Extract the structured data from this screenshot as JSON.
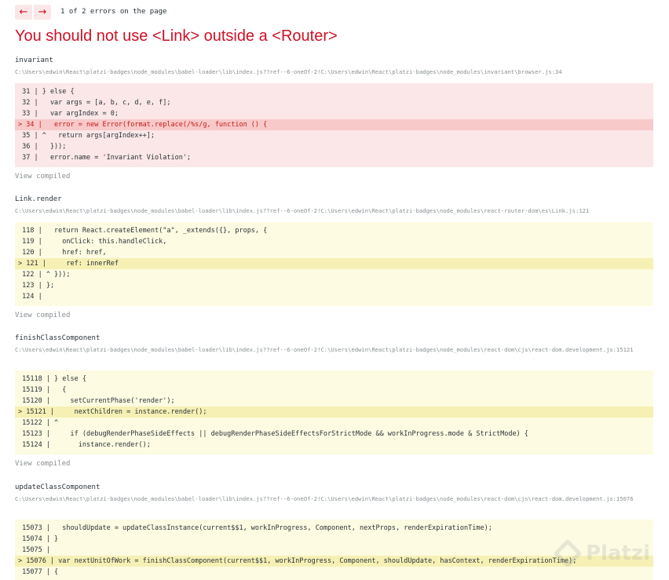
{
  "nav": {
    "prev": "←",
    "next": "→",
    "count": "1 of 2 errors on the page"
  },
  "title": "You should not use <Link> outside a <Router>",
  "frames": [
    {
      "name": "invariant",
      "file": "C:\\Users\\edwin\\React\\platzi-badges\\node_modules\\babel-loader\\lib\\index.js??ref--6-oneOf-2!C:\\Users\\edwin\\React\\platzi-badges\\node_modules\\invariant\\browser.js:34",
      "view": "View compiled",
      "lines": [
        " 31 | } else {",
        " 32 |   var args = [a, b, c, d, e, f];",
        " 33 |   var argIndex = 0;",
        "> 34 |   error = new Error(format.replace(/%s/g, function () {",
        " 35 | ^   return args[argIndex++];",
        " 36 |   }));",
        " 37 |   error.name = 'Invariant Violation';"
      ]
    },
    {
      "name": "Link.render",
      "file": "C:\\Users\\edwin\\React\\platzi-badges\\node_modules\\babel-loader\\lib\\index.js??ref--6-oneOf-2!C:\\Users\\edwin\\React\\platzi-badges\\node_modules\\react-router-dom\\es\\Link.js:121",
      "view": "View compiled",
      "lines": [
        " 118 |   return React.createElement(\"a\", _extends({}, props, {",
        " 119 |     onClick: this.handleClick,",
        " 120 |     href: href,",
        "> 121 |     ref: innerRef",
        " 122 | ^ }));",
        " 123 | };",
        " 124 |"
      ]
    },
    {
      "name": "finishClassComponent",
      "file": "C:\\Users\\edwin\\React\\platzi-badges\\node_modules\\babel-loader\\lib\\index.js??ref--6-oneOf-2!C:\\Users\\edwin\\React\\platzi-badges\\node_modules\\react-dom\\cjs\\react-dom.development.js:15121",
      "view": "View compiled",
      "lines": [
        " 15118 | } else {",
        " 15119 |   {",
        " 15120 |     setCurrentPhase('render');",
        "> 15121 |     nextChildren = instance.render();",
        " 15122 | ^",
        " 15123 |     if (debugRenderPhaseSideEffects || debugRenderPhaseSideEffectsForStrictMode && workInProgress.mode & StrictMode) {",
        " 15124 |       instance.render();"
      ]
    },
    {
      "name": "updateClassComponent",
      "file": "C:\\Users\\edwin\\React\\platzi-badges\\node_modules\\babel-loader\\lib\\index.js??ref--6-oneOf-2!C:\\Users\\edwin\\React\\platzi-badges\\node_modules\\react-dom\\cjs\\react-dom.development.js:15076",
      "lines": [
        " 15073 |   shouldUpdate = updateClassInstance(current$$1, workInProgress, Component, nextProps, renderExpirationTime);",
        " 15074 | }",
        " 15075 |",
        "> 15076 | var nextUnitOfWork = finishClassComponent(current$$1, workInProgress, Component, shouldUpdate, hasContext, renderExpirationTime);",
        " 15077 | {"
      ]
    }
  ],
  "watermark": "Platzi"
}
